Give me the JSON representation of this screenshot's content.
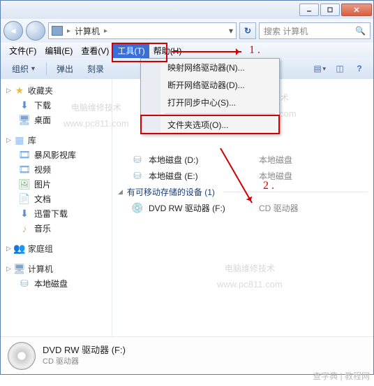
{
  "titlebar": {
    "minimize": "minimize",
    "maximize": "maximize",
    "close": "close"
  },
  "address": {
    "crumb1": "计算机",
    "arrow": "▸"
  },
  "search": {
    "placeholder": "搜索 计算机"
  },
  "menubar": {
    "file": "文件(F)",
    "edit": "编辑(E)",
    "view": "查看(V)",
    "tools": "工具(T)",
    "help": "帮助(H)"
  },
  "toolbar": {
    "organize": "组织",
    "eject": "弹出",
    "burn": "刻录"
  },
  "dropdown": {
    "map_network": "映射网络驱动器(N)...",
    "disconnect_network": "断开网络驱动器(D)...",
    "open_sync": "打开同步中心(S)...",
    "folder_options": "文件夹选项(O)..."
  },
  "sidebar": {
    "favorites": {
      "header": "收藏夹",
      "items": [
        {
          "label": "下载"
        },
        {
          "label": "桌面"
        }
      ]
    },
    "libraries": {
      "header": "库",
      "items": [
        {
          "label": "暴风影视库"
        },
        {
          "label": "视频"
        },
        {
          "label": "图片"
        },
        {
          "label": "文档"
        },
        {
          "label": "迅雷下载"
        },
        {
          "label": "音乐"
        }
      ]
    },
    "homegroup": {
      "header": "家庭组"
    },
    "computer": {
      "header": "计算机",
      "items": [
        {
          "label": "本地磁盘"
        }
      ]
    }
  },
  "main": {
    "drive_d": {
      "label": "本地磁盘 (D:)",
      "meta": "本地磁盘"
    },
    "drive_e": {
      "label": "本地磁盘 (E:)",
      "meta": "本地磁盘"
    },
    "removable_header": "有可移动存储的设备 (1)",
    "dvd": {
      "label": "DVD RW 驱动器 (F:)",
      "meta": "CD 驱动器"
    }
  },
  "detail": {
    "title": "DVD RW 驱动器 (F:)",
    "subtitle": "CD 驱动器"
  },
  "annotations": {
    "num1": "1 .",
    "num2": "2 ."
  },
  "watermarks": {
    "line1": "电脑维修技术",
    "line2": "www.pc811.com",
    "corner": "查字典 | 教程网"
  }
}
